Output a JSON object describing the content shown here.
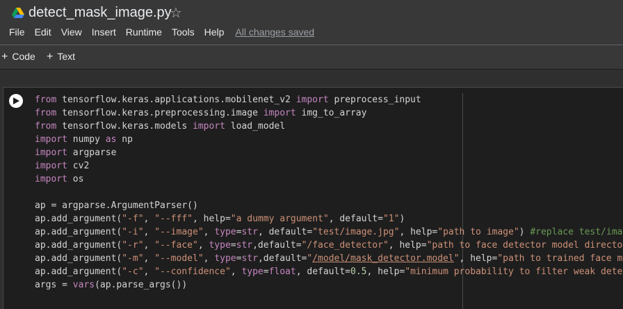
{
  "header": {
    "title": "detect_mask_image.py",
    "star_glyph": "☆",
    "menus": [
      "File",
      "Edit",
      "View",
      "Insert",
      "Runtime",
      "Tools",
      "Help"
    ],
    "status": "All changes saved"
  },
  "toolbar": {
    "code_label": "Code",
    "text_label": "Text",
    "plus_glyph": "+"
  },
  "code_lines": [
    [
      {
        "t": "from",
        "c": "kw"
      },
      {
        "t": " tensorflow.keras.applications.mobilenet_v2 "
      },
      {
        "t": "import",
        "c": "kw"
      },
      {
        "t": " preprocess_input"
      }
    ],
    [
      {
        "t": "from",
        "c": "kw"
      },
      {
        "t": " tensorflow.keras.preprocessing.image "
      },
      {
        "t": "import",
        "c": "kw"
      },
      {
        "t": " img_to_array"
      }
    ],
    [
      {
        "t": "from",
        "c": "kw"
      },
      {
        "t": " tensorflow.keras.models "
      },
      {
        "t": "import",
        "c": "kw"
      },
      {
        "t": " load_model"
      }
    ],
    [
      {
        "t": "import",
        "c": "kw"
      },
      {
        "t": " numpy "
      },
      {
        "t": "as",
        "c": "kw"
      },
      {
        "t": " np"
      }
    ],
    [
      {
        "t": "import",
        "c": "kw"
      },
      {
        "t": " argparse"
      }
    ],
    [
      {
        "t": "import",
        "c": "kw"
      },
      {
        "t": " cv2"
      }
    ],
    [
      {
        "t": "import",
        "c": "kw"
      },
      {
        "t": " os"
      }
    ],
    [],
    [
      {
        "t": "ap = argparse.ArgumentParser()"
      }
    ],
    [
      {
        "t": "ap.add_argument("
      },
      {
        "t": "\"-f\"",
        "c": "str"
      },
      {
        "t": ", "
      },
      {
        "t": "\"--fff\"",
        "c": "str"
      },
      {
        "t": ", help="
      },
      {
        "t": "\"a dummy argument\"",
        "c": "str"
      },
      {
        "t": ", default="
      },
      {
        "t": "\"1\"",
        "c": "str"
      },
      {
        "t": ")"
      }
    ],
    [
      {
        "t": "ap.add_argument("
      },
      {
        "t": "\"-i\"",
        "c": "str"
      },
      {
        "t": ", "
      },
      {
        "t": "\"--image\"",
        "c": "str"
      },
      {
        "t": ", "
      },
      {
        "t": "type",
        "c": "kw"
      },
      {
        "t": "="
      },
      {
        "t": "str",
        "c": "kw"
      },
      {
        "t": ", default="
      },
      {
        "t": "\"test/image.jpg\"",
        "c": "str"
      },
      {
        "t": ", help="
      },
      {
        "t": "\"path to image\"",
        "c": "str"
      },
      {
        "t": ") "
      },
      {
        "t": "#replace test/image",
        "c": "cmt"
      }
    ],
    [
      {
        "t": "ap.add_argument("
      },
      {
        "t": "\"-r\"",
        "c": "str"
      },
      {
        "t": ", "
      },
      {
        "t": "\"--face\"",
        "c": "str"
      },
      {
        "t": ", "
      },
      {
        "t": "type",
        "c": "kw"
      },
      {
        "t": "="
      },
      {
        "t": "str",
        "c": "kw"
      },
      {
        "t": ",default="
      },
      {
        "t": "\"/face_detector\"",
        "c": "str"
      },
      {
        "t": ", help="
      },
      {
        "t": "\"path to face detector model directory",
        "c": "str"
      }
    ],
    [
      {
        "t": "ap.add_argument("
      },
      {
        "t": "\"-m\"",
        "c": "str"
      },
      {
        "t": ", "
      },
      {
        "t": "\"--model\"",
        "c": "str"
      },
      {
        "t": ", "
      },
      {
        "t": "type",
        "c": "kw"
      },
      {
        "t": "="
      },
      {
        "t": "str",
        "c": "kw"
      },
      {
        "t": ",default="
      },
      {
        "t": "\"",
        "c": "str"
      },
      {
        "t": "/model/mask_detector.model",
        "c": "str under"
      },
      {
        "t": "\"",
        "c": "str"
      },
      {
        "t": ", help="
      },
      {
        "t": "\"path to trained face mas",
        "c": "str"
      }
    ],
    [
      {
        "t": "ap.add_argument("
      },
      {
        "t": "\"-c\"",
        "c": "str"
      },
      {
        "t": ", "
      },
      {
        "t": "\"--confidence\"",
        "c": "str"
      },
      {
        "t": ", "
      },
      {
        "t": "type",
        "c": "kw"
      },
      {
        "t": "="
      },
      {
        "t": "float",
        "c": "kw"
      },
      {
        "t": ", default="
      },
      {
        "t": "0.5",
        "c": "num"
      },
      {
        "t": ", help="
      },
      {
        "t": "\"minimum probability to filter weak detect",
        "c": "str"
      }
    ],
    [
      {
        "t": "args = "
      },
      {
        "t": "vars",
        "c": "kw"
      },
      {
        "t": "(ap.parse_args())"
      }
    ]
  ]
}
